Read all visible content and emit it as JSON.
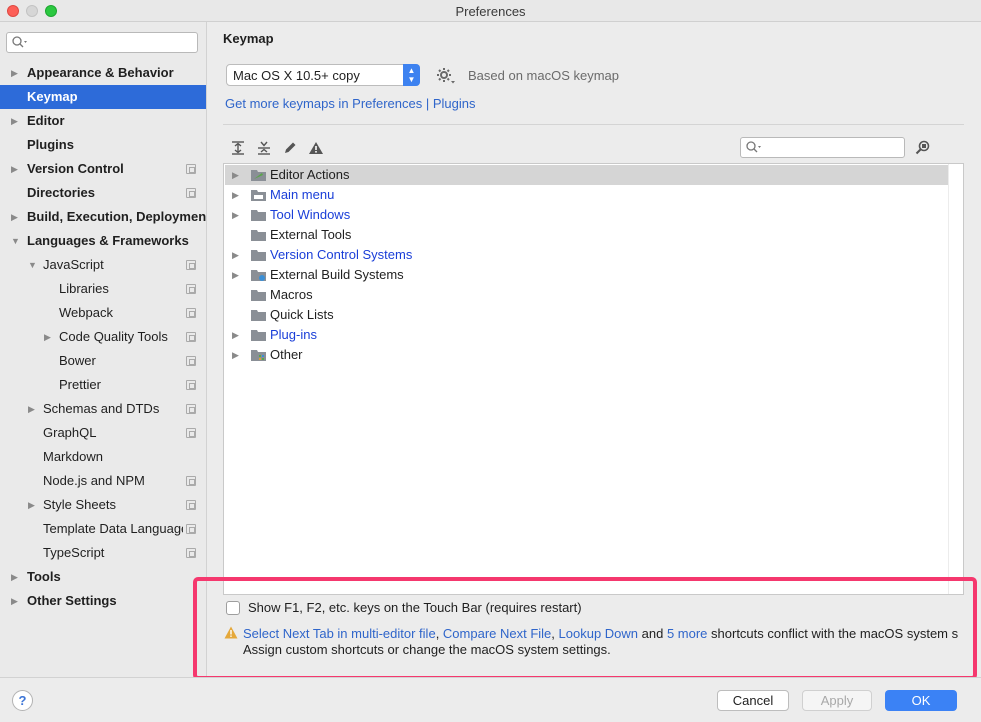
{
  "window": {
    "title": "Preferences"
  },
  "sidebar": {
    "search_placeholder": "",
    "items": [
      {
        "label": "Appearance & Behavior",
        "arrow": "▶"
      },
      {
        "label": "Keymap",
        "arrow": ""
      },
      {
        "label": "Editor",
        "arrow": "▶"
      },
      {
        "label": "Plugins",
        "arrow": ""
      },
      {
        "label": "Version Control",
        "arrow": "▶"
      },
      {
        "label": "Directories",
        "arrow": ""
      },
      {
        "label": "Build, Execution, Deployment",
        "arrow": "▶"
      },
      {
        "label": "Languages & Frameworks",
        "arrow": "▼"
      },
      {
        "label": "JavaScript",
        "arrow": "▼"
      },
      {
        "label": "Libraries",
        "arrow": ""
      },
      {
        "label": "Webpack",
        "arrow": ""
      },
      {
        "label": "Code Quality Tools",
        "arrow": "▶"
      },
      {
        "label": "Bower",
        "arrow": ""
      },
      {
        "label": "Prettier",
        "arrow": ""
      },
      {
        "label": "Schemas and DTDs",
        "arrow": "▶"
      },
      {
        "label": "GraphQL",
        "arrow": ""
      },
      {
        "label": "Markdown",
        "arrow": ""
      },
      {
        "label": "Node.js and NPM",
        "arrow": ""
      },
      {
        "label": "Style Sheets",
        "arrow": "▶"
      },
      {
        "label": "Template Data Languages",
        "arrow": ""
      },
      {
        "label": "TypeScript",
        "arrow": ""
      },
      {
        "label": "Tools",
        "arrow": "▶"
      },
      {
        "label": "Other Settings",
        "arrow": "▶"
      }
    ]
  },
  "main": {
    "title": "Keymap",
    "keymap_select": "Mac OS X 10.5+ copy",
    "based_on": "Based on macOS keymap",
    "get_more_link": "Get more keymaps in Preferences | Plugins",
    "tree_search_placeholder": "",
    "tree": [
      {
        "label": "Editor Actions",
        "arrow": "▶"
      },
      {
        "label": "Main menu",
        "arrow": "▶"
      },
      {
        "label": "Tool Windows",
        "arrow": "▶"
      },
      {
        "label": "External Tools",
        "arrow": ""
      },
      {
        "label": "Version Control Systems",
        "arrow": "▶"
      },
      {
        "label": "External Build Systems",
        "arrow": "▶"
      },
      {
        "label": "Macros",
        "arrow": ""
      },
      {
        "label": "Quick Lists",
        "arrow": ""
      },
      {
        "label": "Plug-ins",
        "arrow": "▶"
      },
      {
        "label": "Other",
        "arrow": "▶"
      }
    ],
    "touchbar_label": "Show F1, F2, etc. keys on the Touch Bar (requires restart)",
    "warning": {
      "link1": "Select Next Tab in multi-editor file",
      "sep1": ", ",
      "link2": "Compare Next File",
      "sep2": ", ",
      "link3": "Lookup Down",
      "and": " and ",
      "link4": "5 more",
      "tail": " shortcuts conflict with the macOS system s",
      "line2": "Assign custom shortcuts or change the macOS system settings."
    }
  },
  "footer": {
    "help": "?",
    "cancel": "Cancel",
    "apply": "Apply",
    "ok": "OK"
  },
  "colors": {
    "selection": "#2d6bd9",
    "link": "#2f65ca",
    "highlight_border": "#f5386e",
    "ok_button": "#3b82f5"
  }
}
